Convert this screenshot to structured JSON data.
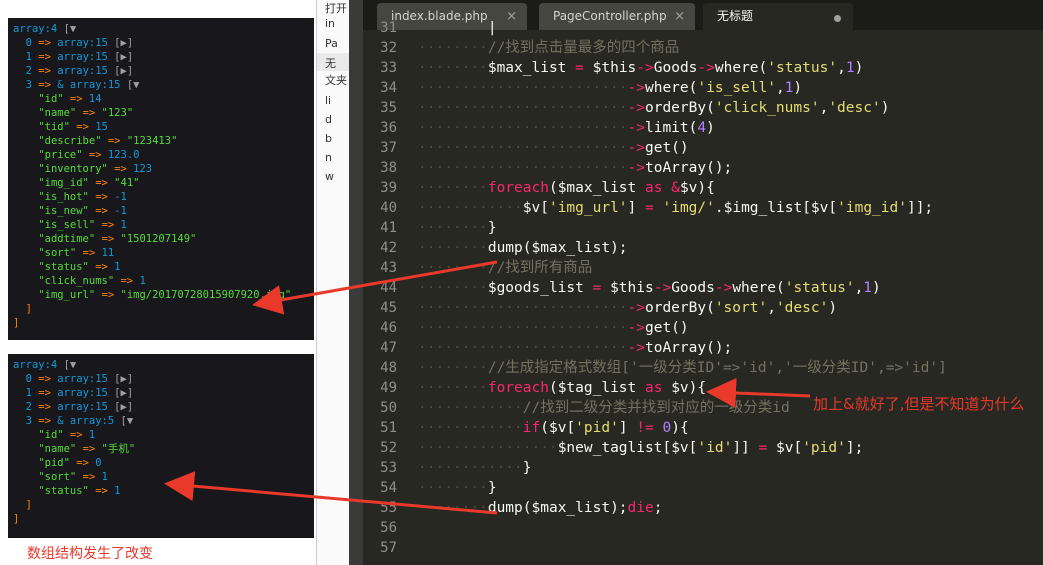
{
  "dump1": {
    "header": "array:4",
    "items": [
      {
        "idx": "0",
        "count": "array:15"
      },
      {
        "idx": "1",
        "count": "array:15"
      },
      {
        "idx": "2",
        "count": "array:15"
      }
    ],
    "expanded_idx": "3",
    "expanded_count": "& array:15",
    "fields": [
      {
        "key": "\"id\"",
        "val": "14",
        "type": "n"
      },
      {
        "key": "\"name\"",
        "val": "\"123\"",
        "type": "s"
      },
      {
        "key": "\"tid\"",
        "val": "15",
        "type": "n"
      },
      {
        "key": "\"describe\"",
        "val": "\"123413\"",
        "type": "s"
      },
      {
        "key": "\"price\"",
        "val": "123.0",
        "type": "n"
      },
      {
        "key": "\"inventory\"",
        "val": "123",
        "type": "n"
      },
      {
        "key": "\"img_id\"",
        "val": "\"41\"",
        "type": "s"
      },
      {
        "key": "\"is_hot\"",
        "val": "-1",
        "type": "n"
      },
      {
        "key": "\"is_new\"",
        "val": "-1",
        "type": "n"
      },
      {
        "key": "\"is_sell\"",
        "val": "1",
        "type": "n"
      },
      {
        "key": "\"addtime\"",
        "val": "\"1501207149\"",
        "type": "s"
      },
      {
        "key": "\"sort\"",
        "val": "11",
        "type": "n"
      },
      {
        "key": "\"status\"",
        "val": "1",
        "type": "n"
      },
      {
        "key": "\"click_nums\"",
        "val": "1",
        "type": "n"
      },
      {
        "key": "\"img_url\"",
        "val": "\"img/20170728015907920.jpg\"",
        "type": "s"
      }
    ]
  },
  "dump2": {
    "header": "array:4",
    "items": [
      {
        "idx": "0",
        "count": "array:15"
      },
      {
        "idx": "1",
        "count": "array:15"
      },
      {
        "idx": "2",
        "count": "array:15"
      }
    ],
    "expanded_idx": "3",
    "expanded_count": "& array:5",
    "fields": [
      {
        "key": "\"id\"",
        "val": "1",
        "type": "n"
      },
      {
        "key": "\"name\"",
        "val": "\"手机\"",
        "type": "s"
      },
      {
        "key": "\"pid\"",
        "val": "0",
        "type": "n"
      },
      {
        "key": "\"sort\"",
        "val": "1",
        "type": "n"
      },
      {
        "key": "\"status\"",
        "val": "1",
        "type": "n"
      }
    ]
  },
  "left_note": "数组结构发生了改变",
  "middle_panel": {
    "items": [
      "打开",
      "in",
      "Pa",
      "无",
      "文夹",
      "li",
      "d",
      "b",
      "n",
      "w"
    ]
  },
  "tabs": [
    {
      "label": "index.blade.php"
    },
    {
      "label": "PageController.php"
    },
    {
      "label": "无标题"
    }
  ],
  "line_numbers": [
    "31",
    "32",
    "33",
    "34",
    "35",
    "36",
    "37",
    "38",
    "39",
    "40",
    "41",
    "42",
    "43",
    "44",
    "45",
    "46",
    "47",
    "48",
    "49",
    "50",
    "51",
    "52",
    "53",
    "54",
    "55",
    "56",
    "57"
  ],
  "code_lines": [
    {
      "indent": "········",
      "text": "|"
    },
    {
      "indent": "········",
      "text": "//找到点击量最多的四个商品"
    },
    {
      "indent": "········",
      "text": "$max_list = $this->Goods->where('status',1)"
    },
    {
      "indent": "························",
      "text": "->where('is_sell',1)"
    },
    {
      "indent": "························",
      "text": "->orderBy('click_nums','desc')"
    },
    {
      "indent": "························",
      "text": "->limit(4)"
    },
    {
      "indent": "························",
      "text": "->get()"
    },
    {
      "indent": "························",
      "text": "->toArray();"
    },
    {
      "indent": "········",
      "text": "foreach($max_list as &$v){"
    },
    {
      "indent": "············",
      "text": "$v['img_url'] = 'img/'.$img_list[$v['img_id']];"
    },
    {
      "indent": "········",
      "text": "}"
    },
    {
      "indent": "········",
      "text": "dump($max_list);"
    },
    {
      "indent": "········",
      "text": "//找到所有商品"
    },
    {
      "indent": "········",
      "text": "$goods_list = $this->Goods->where('status',1)"
    },
    {
      "indent": "························",
      "text": "->orderBy('sort','desc')"
    },
    {
      "indent": "························",
      "text": "->get()"
    },
    {
      "indent": "························",
      "text": "->toArray();"
    },
    {
      "indent": "········",
      "text": "//生成指定格式数组['一级分类ID'=>'id','一级分类ID',=>'id']"
    },
    {
      "indent": "········",
      "text": "foreach($tag_list as $v){"
    },
    {
      "indent": "············",
      "text": "//找到二级分类并找到对应的一级分类id"
    },
    {
      "indent": "············",
      "text": "if($v['pid'] != 0){"
    },
    {
      "indent": "················",
      "text": "$new_taglist[$v['id']] = $v['pid'];"
    },
    {
      "indent": "············",
      "text": "}"
    },
    {
      "indent": "········",
      "text": "}"
    },
    {
      "indent": "········",
      "text": "dump($max_list);die;"
    },
    {
      "indent": "",
      "text": ""
    },
    {
      "indent": "",
      "text": ""
    }
  ],
  "annotation_right": "加上&就好了,但是不知道为什么",
  "colors": {
    "arrow": "#E8392A",
    "editor_bg": "#272822",
    "dump_bg": "#18171B"
  }
}
